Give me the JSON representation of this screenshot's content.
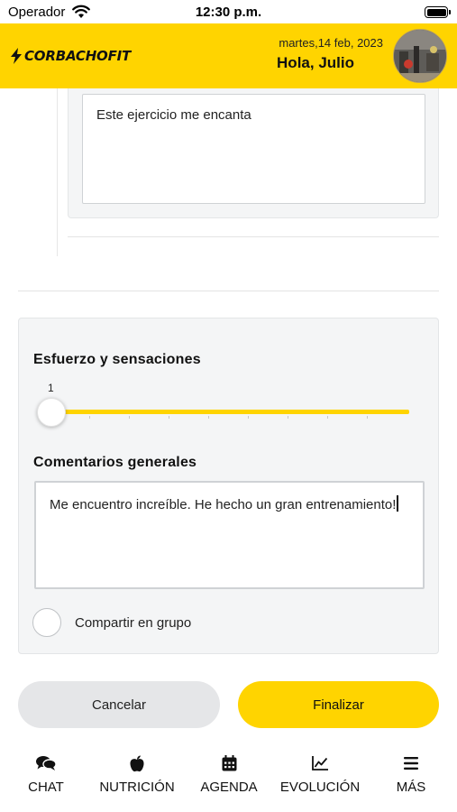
{
  "status_bar": {
    "carrier": "Operador",
    "time": "12:30 p.m."
  },
  "header": {
    "logo_text": "CORBACHOFIT",
    "date": "martes,14 feb, 2023",
    "greeting": "Hola, Julio",
    "accent_color": "#FFD400"
  },
  "previous_entry": {
    "comment_value": "Este ejercicio me encanta"
  },
  "effort": {
    "title": "Esfuerzo y sensaciones",
    "slider_value": "1",
    "slider_min": 1,
    "slider_max": 10
  },
  "comments": {
    "title": "Comentarios generales",
    "value": "Me encuentro increíble. He hecho un gran entrenamiento!"
  },
  "share": {
    "label": "Compartir en grupo",
    "checked": false
  },
  "actions": {
    "cancel_label": "Cancelar",
    "finish_label": "Finalizar"
  },
  "tabs": [
    {
      "label": "CHAT",
      "icon": "chat-icon"
    },
    {
      "label": "NUTRICIÓN",
      "icon": "apple-icon"
    },
    {
      "label": "AGENDA",
      "icon": "calendar-icon"
    },
    {
      "label": "EVOLUCIÓN",
      "icon": "chart-line-icon"
    },
    {
      "label": "MÁS",
      "icon": "menu-icon"
    }
  ]
}
